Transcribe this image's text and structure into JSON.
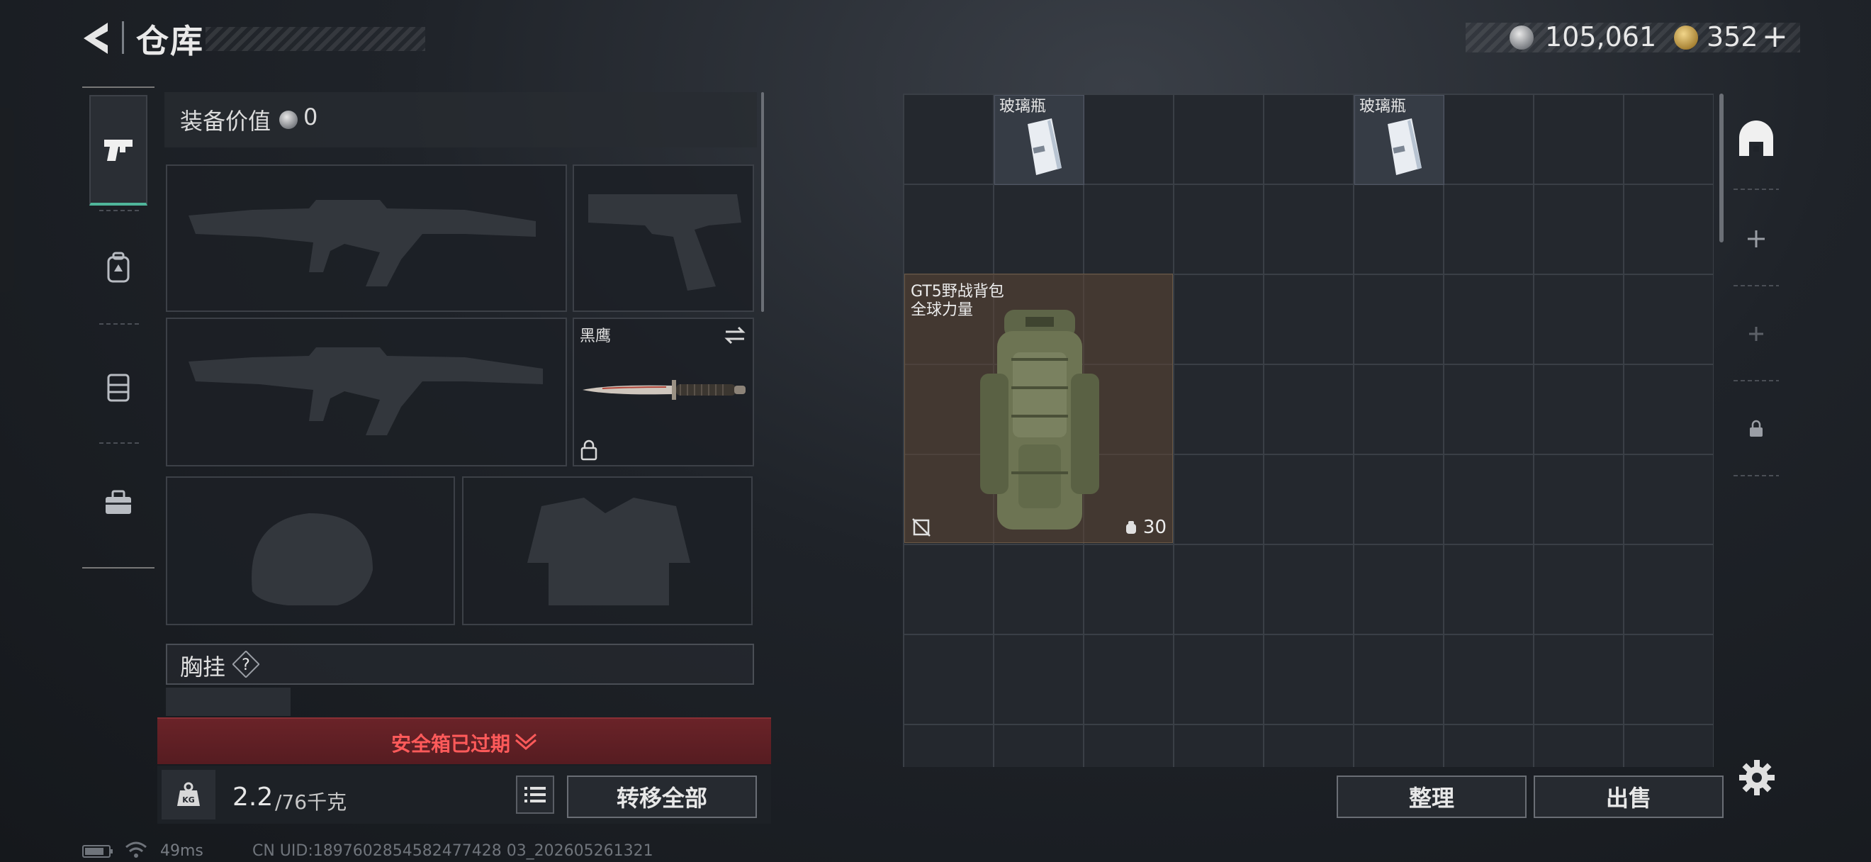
{
  "header": {
    "title": "仓库",
    "currency": {
      "silver_amount": "105,061",
      "gold_amount": "352",
      "add_label": "+"
    }
  },
  "sidebar": {
    "tabs": [
      {
        "name": "weapons",
        "icon": "pistol-icon",
        "active": true
      },
      {
        "name": "backpack",
        "icon": "backpack-icon",
        "active": false
      },
      {
        "name": "rig",
        "icon": "vest-icon",
        "active": false
      },
      {
        "name": "medical",
        "icon": "toolbox-icon",
        "active": false
      }
    ]
  },
  "equipment": {
    "value_label": "装备价值",
    "value": "0",
    "melee_label": "黑鹰",
    "chest_rig_label": "胸挂",
    "help_label": "?"
  },
  "alert": {
    "text": "安全箱已过期"
  },
  "weight": {
    "current": "2.2",
    "total": "/76千克",
    "kg_label": "KG"
  },
  "actions": {
    "transfer_all": "转移全部",
    "sort": "整理",
    "sell": "出售"
  },
  "storage": {
    "items": [
      {
        "name": "玻璃瓶"
      },
      {
        "name": "玻璃瓶"
      }
    ],
    "backpack": {
      "name_line1": "GT5野战背包",
      "name_line2": "全球力量",
      "capacity": "30"
    }
  },
  "status": {
    "ping": "49ms",
    "uid": "CN UID:1897602854582477428 03_202605261321"
  },
  "colors": {
    "accent_green": "#4fb59a",
    "alert_red": "#ff5a5a",
    "alert_bg": "#6a2328"
  }
}
